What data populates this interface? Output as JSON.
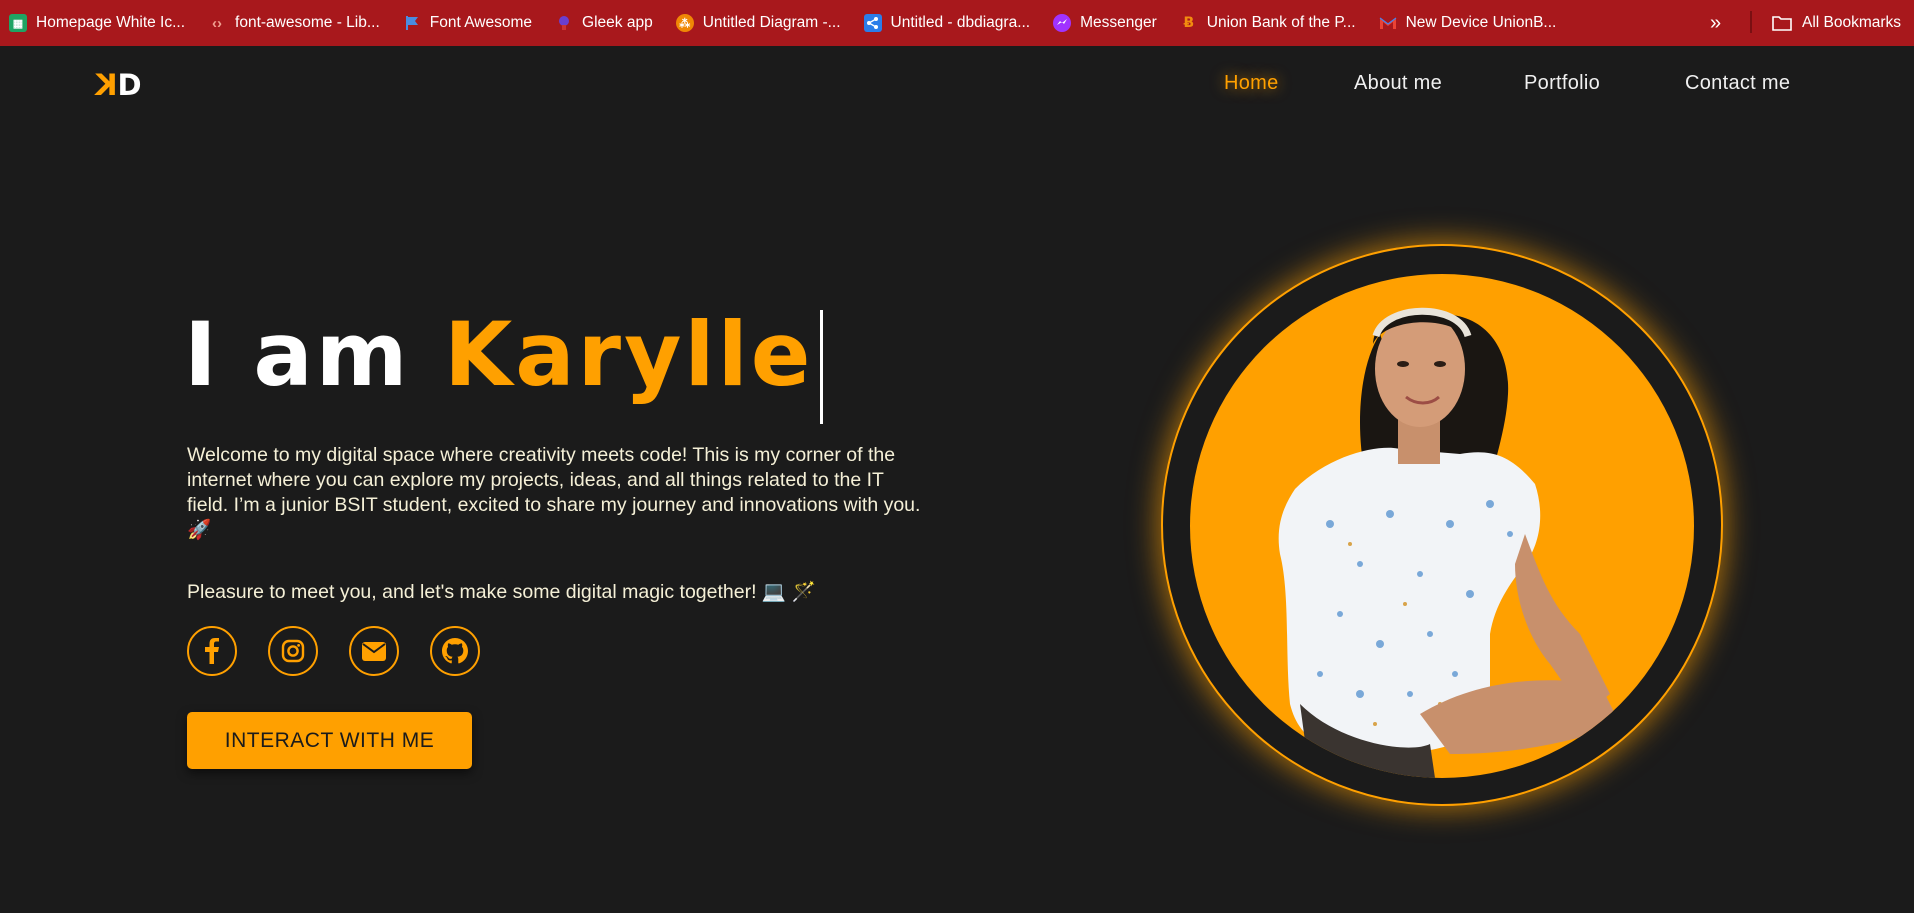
{
  "bookmarks": [
    {
      "label": "Homepage White Ic...",
      "icon": "sheets-icon",
      "color": "#1fa463"
    },
    {
      "label": "font-awesome - Lib...",
      "icon": "code-icon",
      "color": "#e0604a"
    },
    {
      "label": "Font Awesome",
      "icon": "flag-icon",
      "color": "#4a8be0"
    },
    {
      "label": "Gleek app",
      "icon": "gleek-icon",
      "color": "#6a3fd0"
    },
    {
      "label": "Untitled Diagram -...",
      "icon": "drawio-icon",
      "color": "#f08705"
    },
    {
      "label": "Untitled - dbdiagra...",
      "icon": "share-icon",
      "color": "#2b7de9"
    },
    {
      "label": "Messenger",
      "icon": "messenger-icon",
      "color": "#a033ff"
    },
    {
      "label": "Union Bank of the P...",
      "icon": "unionbank-icon",
      "color": "#f28c0f"
    },
    {
      "label": "New Device UnionB...",
      "icon": "gmail-icon",
      "color": "#ea4335"
    }
  ],
  "bookmarks_more": "»",
  "all_bookmarks": "All Bookmarks",
  "logo": {
    "k": "K",
    "d": "D"
  },
  "nav": {
    "home": "Home",
    "about": "About me",
    "portfolio": "Portfolio",
    "contact": "Contact me"
  },
  "hero": {
    "title_prefix": "I am ",
    "title_name": "Karylle",
    "intro": "Welcome to my digital space where creativity meets code! This is my corner of the internet where you can explore my projects, ideas, and all things related to the IT field. I’m a junior BSIT student, excited to share my journey and innovations with you. 🚀",
    "intro2": "Pleasure to meet you, and let's make some digital magic together! 💻 🪄",
    "cta": "INTERACT WITH ME"
  },
  "socials": [
    "facebook-icon",
    "instagram-icon",
    "envelope-icon",
    "github-icon"
  ],
  "colors": {
    "accent": "#ffa000",
    "background": "#1b1b1b",
    "bookmarks_bar": "#a8181c"
  }
}
